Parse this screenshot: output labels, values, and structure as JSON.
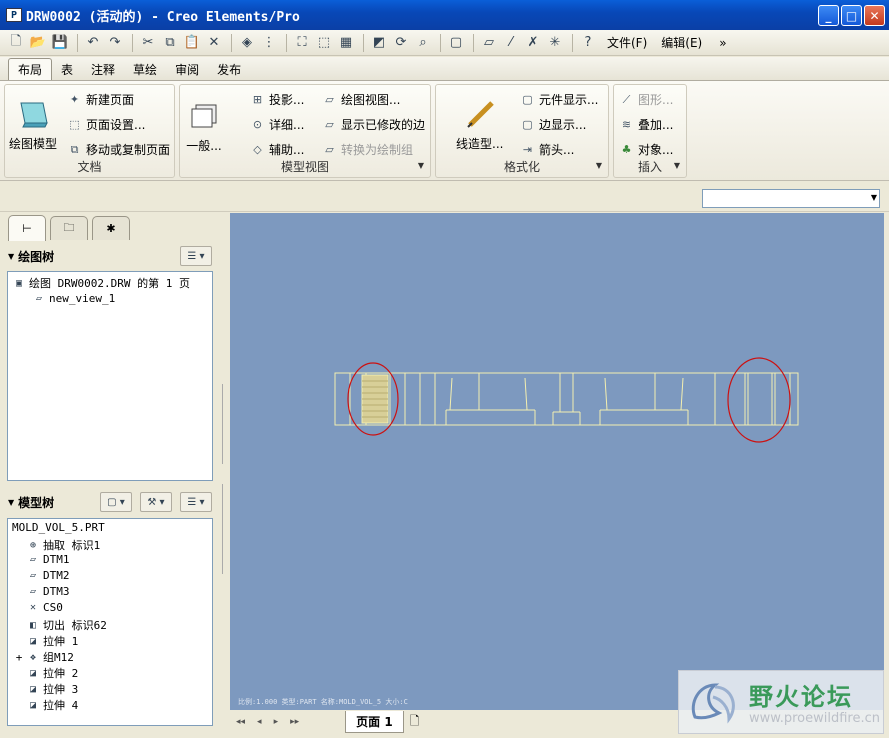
{
  "window": {
    "title": "DRW0002 (活动的) - Creo Elements/Pro",
    "icon_label": "P",
    "min_label": "_",
    "max_label": "□",
    "close_label": "✕"
  },
  "toolbar": {
    "menus": [
      "文件(F)",
      "编辑(E)"
    ],
    "overflow": "»"
  },
  "tabs": [
    "布局",
    "表",
    "注释",
    "草绘",
    "审阅",
    "发布"
  ],
  "active_tab": "布局",
  "ribbon": {
    "document": {
      "title": "文档",
      "big_button": "绘图模型",
      "items": [
        "新建页面",
        "页面设置...",
        "移动或复制页面"
      ]
    },
    "model_view": {
      "title": "模型视图",
      "big_button": "一般...",
      "col1": [
        "投影...",
        "详细...",
        "辅助..."
      ],
      "col2": [
        "绘图视图...",
        "显示已修改的边",
        "转换为绘制组"
      ]
    },
    "format": {
      "title": "格式化",
      "big_button": "线造型...",
      "items": [
        "元件显示...",
        "边显示...",
        "箭头..."
      ]
    },
    "insert": {
      "title": "插入",
      "items": [
        "图形...",
        "叠加...",
        "对象..."
      ]
    }
  },
  "drawing_tree": {
    "title": "绘图树",
    "root": "绘图 DRW0002.DRW 的第 1 页",
    "children": [
      "new_view_1"
    ]
  },
  "model_tree": {
    "title": "模型树",
    "root": "MOLD_VOL_5.PRT",
    "items": [
      {
        "label": "抽取 标识1",
        "icon": "extract-icon",
        "expand": ""
      },
      {
        "label": "DTM1",
        "icon": "datum-plane-icon",
        "expand": ""
      },
      {
        "label": "DTM2",
        "icon": "datum-plane-icon",
        "expand": ""
      },
      {
        "label": "DTM3",
        "icon": "datum-plane-icon",
        "expand": ""
      },
      {
        "label": "CS0",
        "icon": "coordinate-system-icon",
        "expand": ""
      },
      {
        "label": "切出 标识62",
        "icon": "cut-icon",
        "expand": ""
      },
      {
        "label": "拉伸 1",
        "icon": "extrude-icon",
        "expand": ""
      },
      {
        "label": "组M12",
        "icon": "group-icon",
        "expand": "+"
      },
      {
        "label": "拉伸 2",
        "icon": "extrude-icon",
        "expand": ""
      },
      {
        "label": "拉伸 3",
        "icon": "extrude-icon",
        "expand": ""
      },
      {
        "label": "拉伸 4",
        "icon": "extrude-icon",
        "expand": ""
      }
    ]
  },
  "canvas": {
    "status_text": "比例:1.000   类型:PART   名称:MOLD_VOL_5   大小:C",
    "background": "#7d99bf",
    "line_color": "#f4efb0",
    "highlight_color": "#cc1111"
  },
  "footer": {
    "nav": [
      "◂◂",
      "◂",
      "▸",
      "▸▸"
    ],
    "page_tab": "页面 1"
  },
  "watermark": {
    "cn": "野火论坛",
    "url": "www.proewildfire.cn"
  }
}
